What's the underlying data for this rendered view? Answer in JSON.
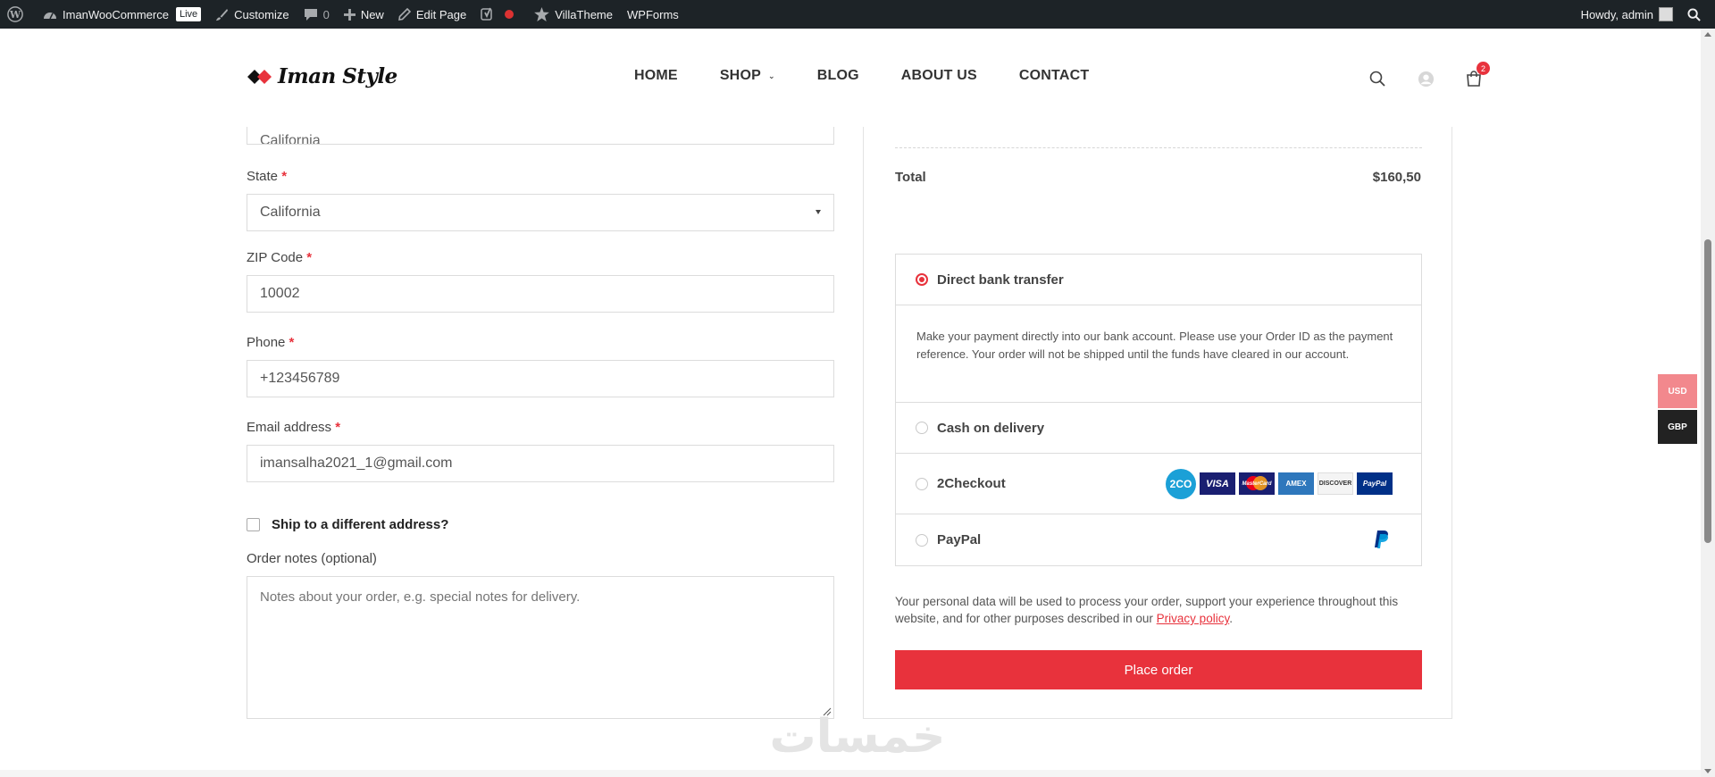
{
  "adminbar": {
    "site_name": "ImanWooCommerce",
    "live_badge": "Live",
    "customize": "Customize",
    "comments_count": "0",
    "new": "New",
    "edit_page": "Edit Page",
    "villatheme": "VillaTheme",
    "wpforms": "WPForms",
    "howdy": "Howdy, admin"
  },
  "header": {
    "logo_text": "Iman Style",
    "nav": [
      "HOME",
      "SHOP",
      "BLOG",
      "ABOUT US",
      "CONTACT"
    ],
    "cart_count": "2"
  },
  "form": {
    "city_value": "California",
    "state_label": "State",
    "state_value": "California",
    "zip_label": "ZIP Code",
    "zip_value": "10002",
    "phone_label": "Phone",
    "phone_value": "+123456789",
    "email_label": "Email address",
    "email_value": "imansalha2021_1@gmail.com",
    "required_mark": "*",
    "ship_label": "Ship to a different address?",
    "notes_label": "Order notes (optional)",
    "notes_placeholder": "Notes about your order, e.g. special notes for delivery."
  },
  "order": {
    "total_label": "Total",
    "total_value": "$160,50",
    "payment_methods": [
      {
        "label": "Direct bank transfer",
        "selected": true
      },
      {
        "label": "Cash on delivery",
        "selected": false
      },
      {
        "label": "2Checkout",
        "selected": false
      },
      {
        "label": "PayPal",
        "selected": false
      }
    ],
    "bank_description": "Make your payment directly into our bank account. Please use your Order ID as the payment reference. Your order will not be shipped until the funds have cleared in our account.",
    "card_logos": [
      "2CO",
      "VISA",
      "MasterCard",
      "AMEX",
      "DISCOVER",
      "PayPal"
    ],
    "privacy_text": "Your personal data will be used to process your order, support your experience throughout this website, and for other purposes described in our ",
    "privacy_link": "Privacy policy",
    "privacy_end": ".",
    "place_order": "Place order"
  },
  "currency": [
    "USD",
    "GBP"
  ],
  "colors": {
    "accent": "#e8323c",
    "adminbar": "#1d2327",
    "usd_bg": "#f2888d",
    "gbp_bg": "#222222"
  },
  "watermark_text": "خمسات"
}
